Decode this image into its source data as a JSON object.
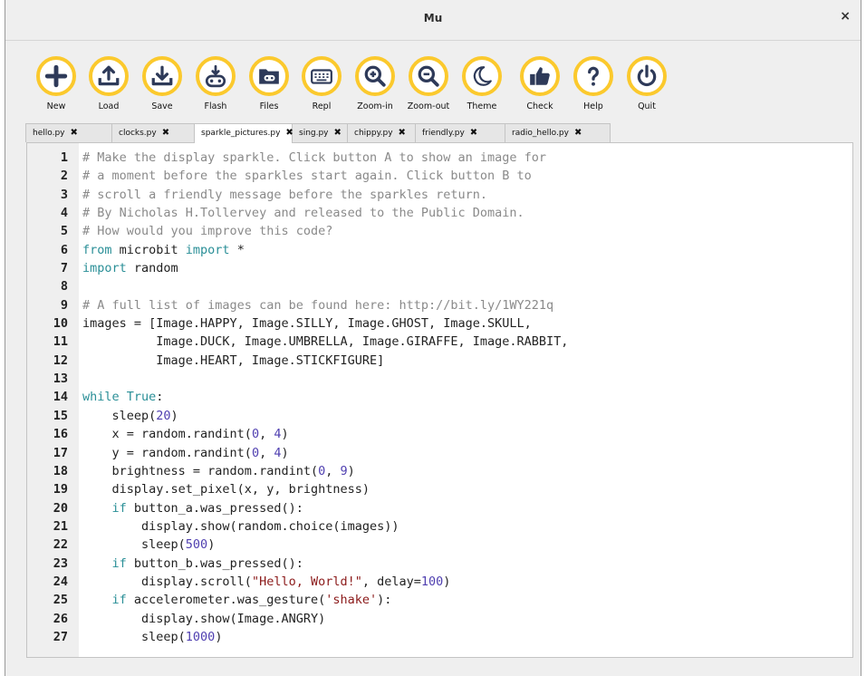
{
  "window": {
    "title": "Mu",
    "close_glyph": "×"
  },
  "accent_color": "#fbc92d",
  "toolbar": [
    {
      "label": "New",
      "icon": "plus-icon"
    },
    {
      "label": "Load",
      "icon": "upload-icon"
    },
    {
      "label": "Save",
      "icon": "download-icon"
    },
    {
      "label": "Flash",
      "icon": "flash-icon"
    },
    {
      "label": "Files",
      "icon": "files-icon"
    },
    {
      "label": "Repl",
      "icon": "keyboard-icon"
    },
    {
      "label": "Zoom-in",
      "icon": "zoom-in-icon"
    },
    {
      "label": "Zoom-out",
      "icon": "zoom-out-icon"
    },
    {
      "label": "Theme",
      "icon": "moon-icon"
    },
    {
      "label": "Check",
      "icon": "thumbs-up-icon"
    },
    {
      "label": "Help",
      "icon": "question-icon"
    },
    {
      "label": "Quit",
      "icon": "power-icon"
    }
  ],
  "tabs": [
    {
      "label": "hello.py",
      "close": "✖"
    },
    {
      "label": "clocks.py",
      "close": "✖"
    },
    {
      "label": "sparkle_pictures.py",
      "close": "✖",
      "active": true
    },
    {
      "label": "sing.py",
      "close": "✖"
    },
    {
      "label": "chippy.py",
      "close": "✖"
    },
    {
      "label": "friendly.py",
      "close": "✖"
    },
    {
      "label": "radio_hello.py",
      "close": "✖"
    }
  ],
  "editor": {
    "lines": [
      [
        [
          "cm",
          "# Make the display sparkle. Click button A to show an image for"
        ]
      ],
      [
        [
          "cm",
          "# a moment before the sparkles start again. Click button B to"
        ]
      ],
      [
        [
          "cm",
          "# scroll a friendly message before the sparkles return."
        ]
      ],
      [
        [
          "cm",
          "# By Nicholas H.Tollervey and released to the Public Domain."
        ]
      ],
      [
        [
          "cm",
          "# How would you improve this code?"
        ]
      ],
      [
        [
          "kw",
          "from"
        ],
        [
          "",
          " microbit "
        ],
        [
          "kw",
          "import"
        ],
        [
          "",
          " *"
        ]
      ],
      [
        [
          "kw",
          "import"
        ],
        [
          "",
          " random"
        ]
      ],
      [],
      [
        [
          "cm",
          "# A full list of images can be found here: http://bit.ly/1WY221q"
        ]
      ],
      [
        [
          "",
          "images = [Image.HAPPY, Image.SILLY, Image.GHOST, Image.SKULL,"
        ]
      ],
      [
        [
          "",
          "          Image.DUCK, Image.UMBRELLA, Image.GIRAFFE, Image.RABBIT,"
        ]
      ],
      [
        [
          "",
          "          Image.HEART, Image.STICKFIGURE]"
        ]
      ],
      [],
      [
        [
          "kw",
          "while"
        ],
        [
          "",
          " "
        ],
        [
          "kw",
          "True"
        ],
        [
          "",
          ":"
        ]
      ],
      [
        [
          "",
          "    sleep("
        ],
        [
          "num",
          "20"
        ],
        [
          "",
          ")"
        ]
      ],
      [
        [
          "",
          "    x = random.randint("
        ],
        [
          "num",
          "0"
        ],
        [
          "",
          ", "
        ],
        [
          "num",
          "4"
        ],
        [
          "",
          ")"
        ]
      ],
      [
        [
          "",
          "    y = random.randint("
        ],
        [
          "num",
          "0"
        ],
        [
          "",
          ", "
        ],
        [
          "num",
          "4"
        ],
        [
          "",
          ")"
        ]
      ],
      [
        [
          "",
          "    brightness = random.randint("
        ],
        [
          "num",
          "0"
        ],
        [
          "",
          ", "
        ],
        [
          "num",
          "9"
        ],
        [
          "",
          ")"
        ]
      ],
      [
        [
          "",
          "    display.set_pixel(x, y, brightness)"
        ]
      ],
      [
        [
          "",
          "    "
        ],
        [
          "kw",
          "if"
        ],
        [
          "",
          " button_a.was_pressed():"
        ]
      ],
      [
        [
          "",
          "        display.show(random.choice(images))"
        ]
      ],
      [
        [
          "",
          "        sleep("
        ],
        [
          "num",
          "500"
        ],
        [
          "",
          ")"
        ]
      ],
      [
        [
          "",
          "    "
        ],
        [
          "kw",
          "if"
        ],
        [
          "",
          " button_b.was_pressed():"
        ]
      ],
      [
        [
          "",
          "        display.scroll("
        ],
        [
          "str",
          "\"Hello, World!\""
        ],
        [
          "",
          ", delay="
        ],
        [
          "num",
          "100"
        ],
        [
          "",
          ")"
        ]
      ],
      [
        [
          "",
          "    "
        ],
        [
          "kw",
          "if"
        ],
        [
          "",
          " accelerometer.was_gesture("
        ],
        [
          "str",
          "'shake'"
        ],
        [
          "",
          "):"
        ]
      ],
      [
        [
          "",
          "        display.show(Image.ANGRY)"
        ]
      ],
      [
        [
          "",
          "        sleep("
        ],
        [
          "num",
          "1000"
        ],
        [
          "",
          ")"
        ]
      ]
    ]
  }
}
